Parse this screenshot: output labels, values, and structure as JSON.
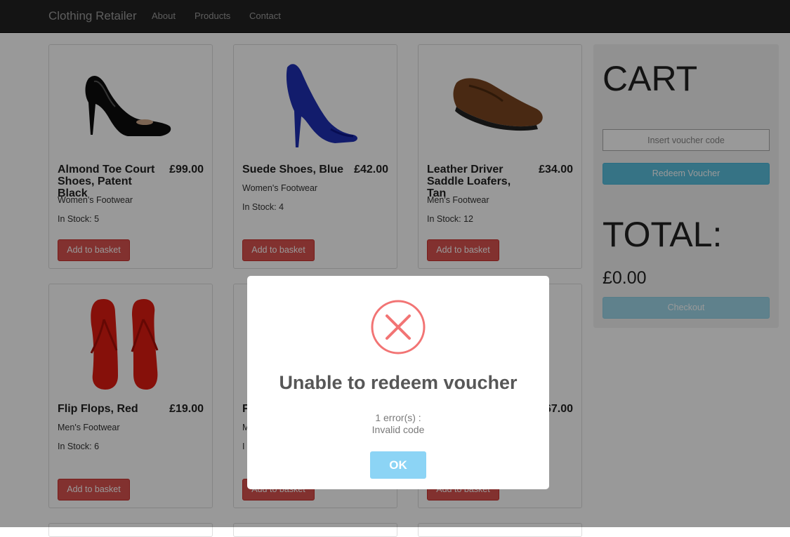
{
  "navbar": {
    "brand": "Clothing Retailer",
    "links": [
      "About",
      "Products",
      "Contact"
    ]
  },
  "products": [
    {
      "name": "Almond Toe Court Shoes, Patent Black",
      "price": "£99.00",
      "category": "Women's Footwear",
      "stock": "In Stock: 5",
      "button": "Add to basket",
      "image": "black-patent-court-shoe"
    },
    {
      "name": "Suede Shoes, Blue",
      "price": "£42.00",
      "category": "Women's Footwear",
      "stock": "In Stock: 4",
      "button": "Add to basket",
      "image": "blue-suede-peep-toe-heel"
    },
    {
      "name": "Leather Driver Saddle Loafers, Tan",
      "price": "£34.00",
      "category": "Men's Footwear",
      "stock": "In Stock: 12",
      "button": "Add to basket",
      "image": "tan-leather-loafer"
    },
    {
      "name": "Flip Flops, Red",
      "price": "£19.00",
      "category": "Men's Footwear",
      "stock": "In Stock: 6",
      "button": "Add to basket",
      "image": "red-flip-flops"
    },
    {
      "name": "F",
      "category": "M",
      "stock": "I",
      "button": "Add to basket"
    },
    {
      "price": "£67.00",
      "button": "Add to basket"
    }
  ],
  "cart": {
    "title": "CART",
    "voucher_placeholder": "Insert voucher code",
    "redeem_label": "Redeem Voucher",
    "total_label": "TOTAL:",
    "total_value": "£0.00",
    "checkout_label": "Checkout"
  },
  "modal": {
    "icon": "error-x-icon",
    "title": "Unable to redeem voucher",
    "line1": "1 error(s) :",
    "line2": "Invalid code",
    "ok_label": "OK"
  },
  "colors": {
    "navbar": "#222222",
    "danger": "#d9534f",
    "info": "#5bc0de",
    "error_icon": "#f27474",
    "ok_button": "#8cd4f5"
  }
}
